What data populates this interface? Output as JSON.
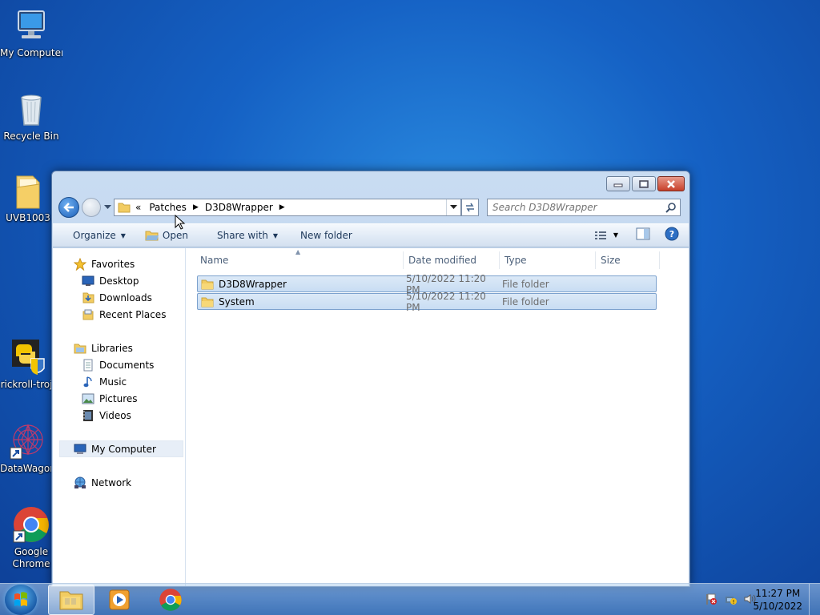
{
  "desktop": {
    "icons": [
      {
        "label": "My Computer"
      },
      {
        "label": "Recycle Bin"
      },
      {
        "label": "UVB1003"
      },
      {
        "label": "rickroll-troj"
      },
      {
        "label": "DataWagon"
      },
      {
        "label": "Google Chrome"
      }
    ]
  },
  "explorer": {
    "address": {
      "overflow": "«",
      "crumbs": [
        "Patches",
        "D3D8Wrapper"
      ]
    },
    "search": {
      "placeholder": "Search D3D8Wrapper"
    },
    "toolbar": {
      "organize": "Organize",
      "open": "Open",
      "share_with": "Share with",
      "new_folder": "New folder"
    },
    "nav": {
      "favorites": "Favorites",
      "desktop": "Desktop",
      "downloads": "Downloads",
      "recent_places": "Recent Places",
      "libraries": "Libraries",
      "documents": "Documents",
      "music": "Music",
      "pictures": "Pictures",
      "videos": "Videos",
      "my_computer": "My Computer",
      "network": "Network"
    },
    "columns": {
      "name": "Name",
      "date_modified": "Date modified",
      "type": "Type",
      "size": "Size"
    },
    "files": [
      {
        "name": "D3D8Wrapper",
        "date": "5/10/2022 11:20 PM",
        "type": "File folder",
        "size": ""
      },
      {
        "name": "System",
        "date": "5/10/2022 11:20 PM",
        "type": "File folder",
        "size": ""
      }
    ]
  },
  "taskbar": {
    "time": "11:27 PM",
    "date": "5/10/2022"
  },
  "colors": {
    "selection": "#c8ddf3",
    "accent": "#1561c4"
  }
}
